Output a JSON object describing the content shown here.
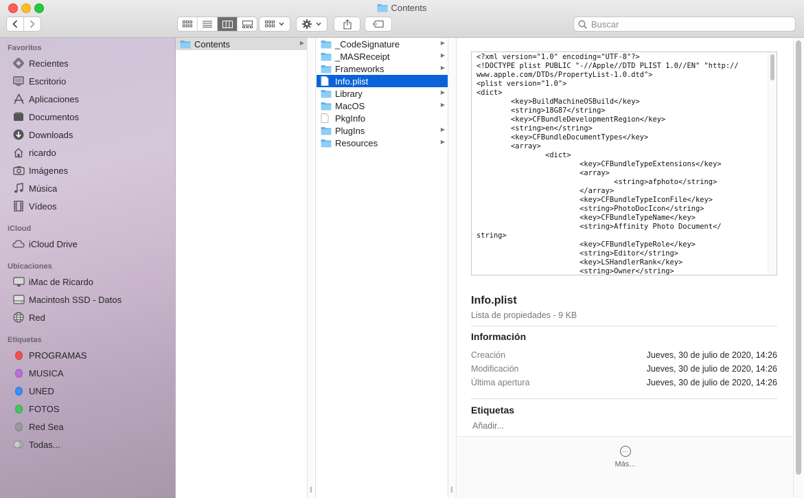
{
  "window": {
    "title": "Contents"
  },
  "search": {
    "placeholder": "Buscar"
  },
  "sidebar": {
    "favorites_header": "Favoritos",
    "favorites": [
      {
        "label": "Recientes",
        "icon": "clock-icon"
      },
      {
        "label": "Escritorio",
        "icon": "desktop-icon"
      },
      {
        "label": "Aplicaciones",
        "icon": "apps-icon"
      },
      {
        "label": "Documentos",
        "icon": "document-icon"
      },
      {
        "label": "Downloads",
        "icon": "download-icon"
      },
      {
        "label": "ricardo",
        "icon": "home-icon"
      },
      {
        "label": "Imágenes",
        "icon": "camera-icon"
      },
      {
        "label": "Música",
        "icon": "music-icon"
      },
      {
        "label": "Vídeos",
        "icon": "film-icon"
      }
    ],
    "icloud_header": "iCloud",
    "icloud": [
      {
        "label": "iCloud Drive",
        "icon": "cloud-icon"
      }
    ],
    "locations_header": "Ubicaciones",
    "locations": [
      {
        "label": "iMac de Ricardo",
        "icon": "monitor-icon"
      },
      {
        "label": "Macintosh SSD - Datos",
        "icon": "disk-icon"
      },
      {
        "label": "Red",
        "icon": "network-icon"
      }
    ],
    "tags_header": "Etiquetas",
    "tags": [
      {
        "label": "PROGRAMAS",
        "color": "#f0514f"
      },
      {
        "label": "MUSICA",
        "color": "#b96ed8"
      },
      {
        "label": "UNED",
        "color": "#3b8ef5"
      },
      {
        "label": "FOTOS",
        "color": "#45c45a"
      },
      {
        "label": "Red Sea",
        "color": "#9a9a9a"
      },
      {
        "label": "Todas...",
        "color": "#aaaaaa"
      }
    ]
  },
  "column1": {
    "items": [
      {
        "label": "Contents"
      }
    ]
  },
  "column2": {
    "items": [
      {
        "label": "_CodeSignature",
        "type": "folder"
      },
      {
        "label": "_MASReceipt",
        "type": "folder"
      },
      {
        "label": "Frameworks",
        "type": "folder"
      },
      {
        "label": "Info.plist",
        "type": "file"
      },
      {
        "label": "Library",
        "type": "folder"
      },
      {
        "label": "MacOS",
        "type": "folder"
      },
      {
        "label": "PkgInfo",
        "type": "file"
      },
      {
        "label": "PlugIns",
        "type": "folder"
      },
      {
        "label": "Resources",
        "type": "folder"
      }
    ]
  },
  "preview": {
    "code": "<?xml version=\"1.0\" encoding=\"UTF-8\"?>\n<!DOCTYPE plist PUBLIC \"-//Apple//DTD PLIST 1.0//EN\" \"http://\nwww.apple.com/DTDs/PropertyList-1.0.dtd\">\n<plist version=\"1.0\">\n<dict>\n        <key>BuildMachineOSBuild</key>\n        <string>18G87</string>\n        <key>CFBundleDevelopmentRegion</key>\n        <string>en</string>\n        <key>CFBundleDocumentTypes</key>\n        <array>\n                <dict>\n                        <key>CFBundleTypeExtensions</key>\n                        <array>\n                                <string>afphoto</string>\n                        </array>\n                        <key>CFBundleTypeIconFile</key>\n                        <string>PhotoDocIcon</string>\n                        <key>CFBundleTypeName</key>\n                        <string>Affinity Photo Document</\nstring>\n                        <key>CFBundleTypeRole</key>\n                        <string>Editor</string>\n                        <key>LSHandlerRank</key>\n                        <string>Owner</string>",
    "file_name": "Info.plist",
    "file_kind": "Lista de propiedades - 9 KB",
    "info_header": "Información",
    "info_rows": [
      {
        "key": "Creación",
        "value": "Jueves, 30 de julio de 2020, 14:26"
      },
      {
        "key": "Modificación",
        "value": "Jueves, 30 de julio de 2020, 14:26"
      },
      {
        "key": "Última apertura",
        "value": "Jueves, 30 de julio de 2020, 14:26"
      }
    ],
    "tags_header": "Etiquetas",
    "tags_placeholder": "Añadir...",
    "more_label": "Más..."
  }
}
